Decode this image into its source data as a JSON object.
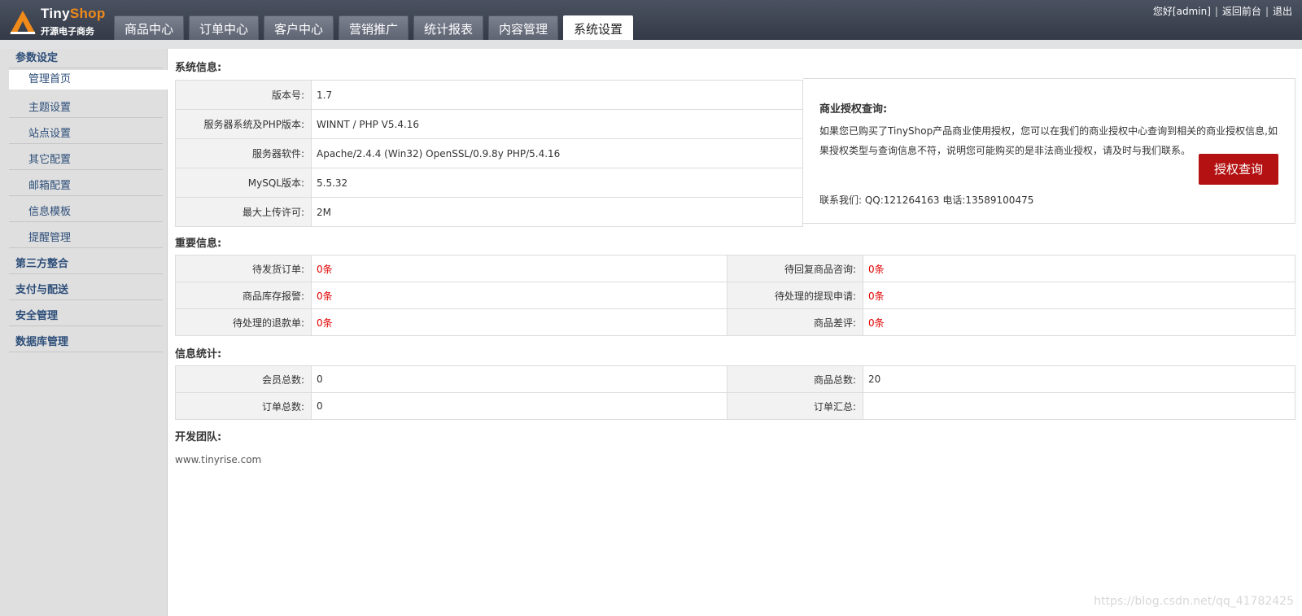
{
  "header": {
    "logo_brand_a": "Tiny",
    "logo_brand_b": "Shop",
    "logo_sub": "开源电子商务",
    "nav_tabs": [
      "商品中心",
      "订单中心",
      "客户中心",
      "营销推广",
      "统计报表",
      "内容管理",
      "系统设置"
    ],
    "active_tab": "系统设置",
    "greeting": "您好[admin]",
    "back_link": "返回前台",
    "logout_link": "退出",
    "separator": "|"
  },
  "sidebar": {
    "group1": "参数设定",
    "items": [
      "管理首页",
      "主题设置",
      "站点设置",
      "其它配置",
      "邮箱配置",
      "信息模板",
      "提醒管理"
    ],
    "groups": [
      "第三方整合",
      "支付与配送",
      "安全管理",
      "数据库管理"
    ]
  },
  "system_info": {
    "title": "系统信息:",
    "rows": [
      {
        "label": "版本号:",
        "value": "1.7"
      },
      {
        "label": "服务器系统及PHP版本:",
        "value": "WINNT / PHP V5.4.16"
      },
      {
        "label": "服务器软件:",
        "value": "Apache/2.4.4 (Win32) OpenSSL/0.9.8y PHP/5.4.16"
      },
      {
        "label": "MySQL版本:",
        "value": "5.5.32"
      },
      {
        "label": "最大上传许可:",
        "value": "2M"
      }
    ]
  },
  "license": {
    "title": "商业授权查询:",
    "text": "如果您已购买了TinyShop产品商业使用授权，您可以在我们的商业授权中心查询到相关的商业授权信息,如果授权类型与查询信息不符，说明您可能购买的是非法商业授权，请及时与我们联系。",
    "button": "授权查询",
    "contact": "联系我们:  QQ:121264163 电话:13589100475"
  },
  "important": {
    "title": "重要信息:",
    "rows": [
      [
        {
          "label": "待发货订单:",
          "value": "0条"
        },
        {
          "label": "待回复商品咨询:",
          "value": "0条"
        }
      ],
      [
        {
          "label": "商品库存报警:",
          "value": "0条"
        },
        {
          "label": "待处理的提现申请:",
          "value": "0条"
        }
      ],
      [
        {
          "label": "待处理的退款单:",
          "value": "0条"
        },
        {
          "label": "商品差评:",
          "value": "0条"
        }
      ]
    ]
  },
  "stats": {
    "title": "信息统计:",
    "rows": [
      [
        {
          "label": "会员总数:",
          "value": "0"
        },
        {
          "label": "商品总数:",
          "value": "20"
        }
      ],
      [
        {
          "label": "订单总数:",
          "value": "0"
        },
        {
          "label": "订单汇总:",
          "value": ""
        }
      ]
    ]
  },
  "team": {
    "title": "开发团队:",
    "url": "www.tinyrise.com"
  },
  "watermark": "https://blog.csdn.net/qq_41782425",
  "colors": {
    "header_bg": "#3c4250",
    "accent_orange": "#f08a1a",
    "button_red": "#b41212",
    "alert_red": "#e00000",
    "link_blue": "#2d4e79"
  }
}
